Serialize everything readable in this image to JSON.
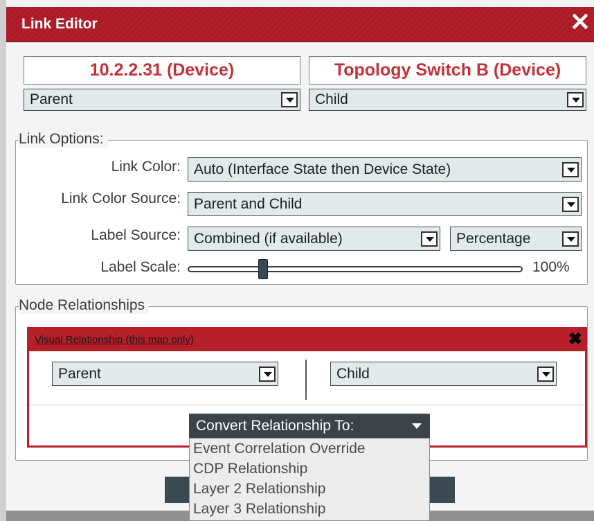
{
  "dialog": {
    "title": "Link Editor",
    "close_glyph": "✕"
  },
  "devices": {
    "left_name": "10.2.2.31 (Device)",
    "right_name": "Topology Switch B (Device)",
    "left_role": "Parent",
    "right_role": "Child"
  },
  "link_options": {
    "legend": "Link Options:",
    "link_color_label": "Link Color:",
    "link_color_value": "Auto (Interface State then Device State)",
    "link_color_source_label": "Link Color Source:",
    "link_color_source_value": "Parent and Child",
    "label_source_label": "Label Source:",
    "label_source_value": "Combined (if available)",
    "label_source_type": "Percentage",
    "label_scale_label": "Label Scale:",
    "label_scale_value": "100%"
  },
  "node_relationships": {
    "legend": "Node Relationships",
    "panel_title": "Visual Relationship (this map only)",
    "panel_close_glyph": "✖",
    "parent_value": "Parent",
    "child_value": "Child",
    "convert_label": "Convert Relationship To:",
    "convert_options": [
      "Event Correlation Override",
      "CDP Relationship",
      "Layer 2 Relationship",
      "Layer 3 Relationship"
    ]
  },
  "colors": {
    "accent_red": "#b71f2b",
    "device_name_red": "#c2323a",
    "select_bg": "#e1e9ea",
    "button_dark": "#3d4449"
  }
}
